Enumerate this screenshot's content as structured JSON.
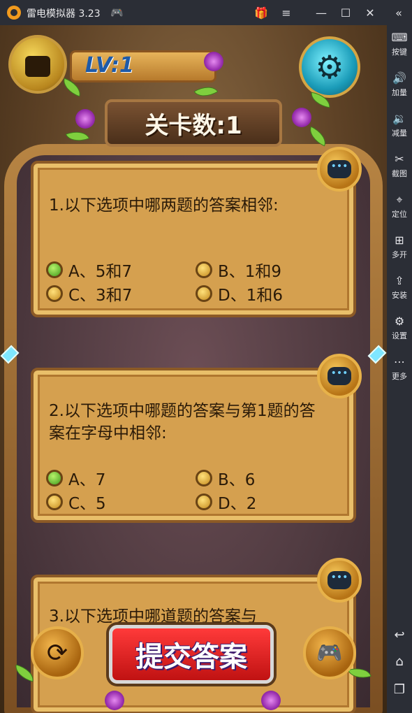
{
  "window": {
    "title": "雷电模拟器 3.23",
    "controls": {
      "gift": "gift-icon",
      "menu": "menu-icon",
      "minimize": "minimize-icon",
      "maximize": "maximize-icon",
      "close": "close-icon",
      "collapse": "collapse-icon"
    }
  },
  "sidebar": {
    "items": [
      {
        "label": "按键",
        "icon": "keyboard-icon",
        "glyph": "⌨"
      },
      {
        "label": "加量",
        "icon": "volume-up-icon",
        "glyph": "🔊"
      },
      {
        "label": "减量",
        "icon": "volume-down-icon",
        "glyph": "🔉"
      },
      {
        "label": "截图",
        "icon": "scissors-icon",
        "glyph": "✂"
      },
      {
        "label": "定位",
        "icon": "location-icon",
        "glyph": "⌖"
      },
      {
        "label": "多开",
        "icon": "multi-instance-icon",
        "glyph": "⊞"
      },
      {
        "label": "安装",
        "icon": "apk-install-icon",
        "glyph": "⇪"
      },
      {
        "label": "设置",
        "icon": "gear-icon",
        "glyph": "⚙"
      },
      {
        "label": "更多",
        "icon": "more-icon",
        "glyph": "⋯"
      }
    ],
    "nav": {
      "back": "↩",
      "home": "⌂",
      "recents": "❐"
    }
  },
  "game": {
    "level_badge": "LV:1",
    "level_title": "关卡数:1",
    "questions": [
      {
        "text": "1.以下选项中哪两题的答案相邻:",
        "options": [
          "A、5和7",
          "B、1和9",
          "C、3和7",
          "D、1和6"
        ],
        "selected": "A"
      },
      {
        "text": "2.以下选项中哪题的答案与第1题的答案在字母中相邻:",
        "options": [
          "A、7",
          "B、6",
          "C、5",
          "D、2"
        ],
        "selected": "A"
      },
      {
        "text": "3.以下选项中哪道题的答案与"
      }
    ],
    "submit_label": "提交答案",
    "colors": {
      "submit": "#e02020",
      "board": "#d5a04f",
      "accent_gear": "#1a9bb8"
    }
  }
}
